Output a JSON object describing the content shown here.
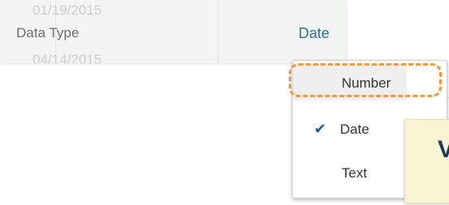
{
  "panel": {
    "ghost_row_top": "01/19/2015",
    "ghost_row_bottom": "04/14/2015",
    "field_label": "Data Type",
    "field_value": "Date"
  },
  "dropdown": {
    "options": [
      {
        "label": "Number",
        "highlighted": true,
        "selected": false
      },
      {
        "label": "Date",
        "highlighted": false,
        "selected": true
      },
      {
        "label": "Text",
        "highlighted": false,
        "selected": false
      }
    ],
    "check_icon": "checkmark-icon"
  },
  "callout": {
    "text": "V"
  },
  "colors": {
    "accent": "#2d6f96",
    "highlight": "#f29a3a",
    "callout_bg": "#f8f6d2",
    "check": "#1f5f8d"
  }
}
